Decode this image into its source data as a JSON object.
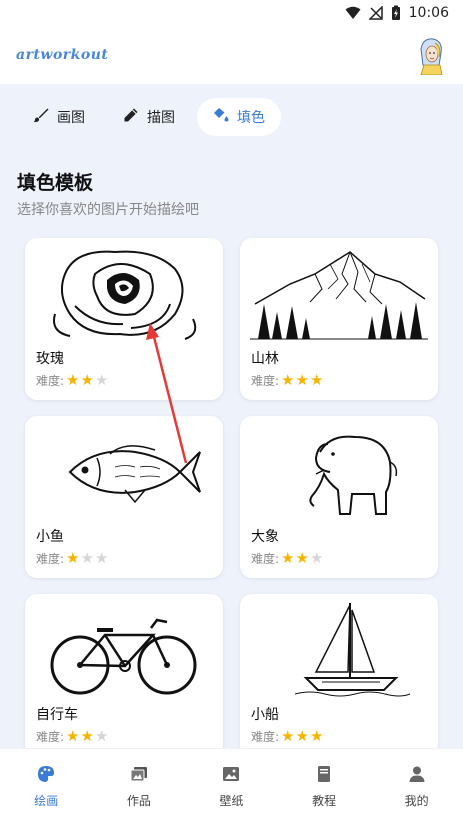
{
  "status_bar": {
    "time": "10:06"
  },
  "header": {
    "logo_text": "artworkout"
  },
  "tabs": [
    {
      "label": "画图",
      "icon": "brush-icon",
      "active": false
    },
    {
      "label": "描图",
      "icon": "pencil-icon",
      "active": false
    },
    {
      "label": "填色",
      "icon": "paint-bucket-icon",
      "active": true
    }
  ],
  "section": {
    "title": "填色模板",
    "subtitle": "选择你喜欢的图片开始描绘吧"
  },
  "difficulty_label": "难度:",
  "templates": [
    {
      "name": "玫瑰",
      "rating": 2,
      "icon": "rose-drawing"
    },
    {
      "name": "山林",
      "rating": 3,
      "icon": "mountain-forest-drawing"
    },
    {
      "name": "小鱼",
      "rating": 1,
      "icon": "fish-drawing"
    },
    {
      "name": "大象",
      "rating": 2,
      "icon": "elephant-drawing"
    },
    {
      "name": "自行车",
      "rating": 2,
      "icon": "bicycle-drawing"
    },
    {
      "name": "小船",
      "rating": 3,
      "icon": "sailboat-drawing"
    }
  ],
  "bottom_nav": [
    {
      "label": "绘画",
      "icon": "palette-icon",
      "active": true
    },
    {
      "label": "作品",
      "icon": "gallery-icon",
      "active": false
    },
    {
      "label": "壁纸",
      "icon": "image-icon",
      "active": false
    },
    {
      "label": "教程",
      "icon": "book-icon",
      "active": false
    },
    {
      "label": "我的",
      "icon": "person-icon",
      "active": false
    }
  ],
  "colors": {
    "accent": "#3a7bd5",
    "content_bg": "#eef2fb",
    "star_on": "#f4b400",
    "star_off": "#d6d6d6",
    "annotation_arrow": "#e53935"
  }
}
